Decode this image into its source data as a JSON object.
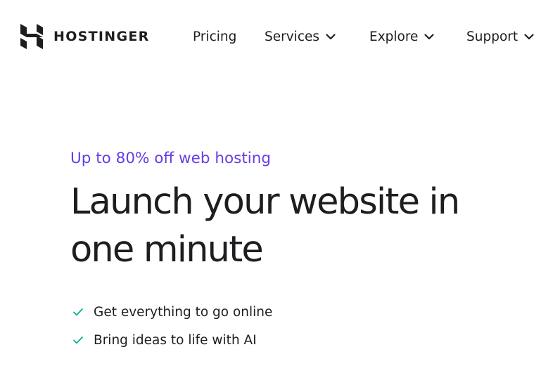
{
  "brand": {
    "name": "HOSTINGER",
    "logo_icon": "hostinger-logo-icon",
    "text_color": "#1d1e20"
  },
  "nav": {
    "pricing": {
      "label": "Pricing"
    },
    "services": {
      "label": "Services",
      "icon": "chevron-down-icon"
    },
    "explore": {
      "label": "Explore",
      "icon": "chevron-down-icon"
    },
    "support": {
      "label": "Support",
      "icon": "chevron-down-icon"
    }
  },
  "hero": {
    "eyebrow": "Up to 80% off web hosting",
    "headline": "Launch your website in one minute",
    "features": [
      {
        "text": "Get everything to go online",
        "icon": "check-icon"
      },
      {
        "text": "Bring ideas to life with AI",
        "icon": "check-icon"
      }
    ]
  },
  "colors": {
    "accent": "#673de6",
    "check": "#00b090",
    "text": "#1d1e20",
    "background": "#ffffff"
  }
}
